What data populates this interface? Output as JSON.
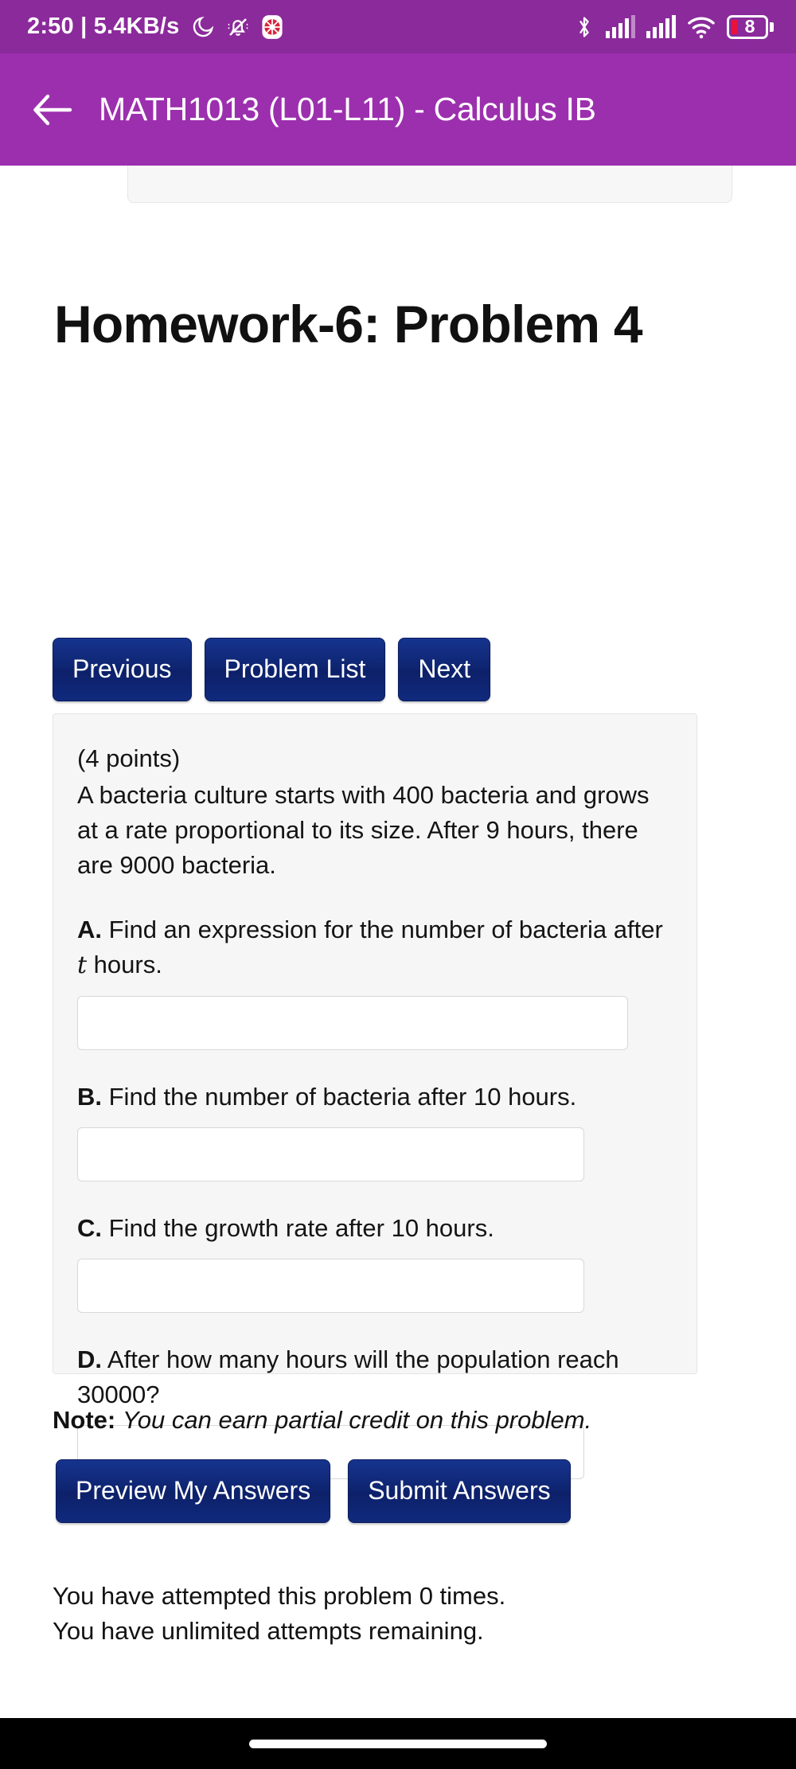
{
  "status_bar": {
    "clock": "2:50",
    "separator": "|",
    "network_speed": "5.4KB/s",
    "icons_left": [
      "dnd-moon-icon",
      "mute-bell-icon",
      "app-badge-icon"
    ],
    "icons_right": [
      "bluetooth-icon",
      "signal-sim1-icon",
      "signal-sim2-icon",
      "wifi-icon"
    ],
    "battery_level": "8",
    "battery_color": "#e8123c",
    "background_color": "#8b2a9b"
  },
  "app_bar": {
    "back_icon": "arrow-left-icon",
    "title": "MATH1013 (L01-L11) - Calculus IB",
    "background_color": "#9c2fae"
  },
  "breadcrumb": {
    "set_name": "homework-6",
    "separator": "/",
    "problem": "4"
  },
  "page": {
    "title": "Homework-6: Problem 4"
  },
  "nav_buttons": {
    "previous": "Previous",
    "problem_list": "Problem List",
    "next": "Next",
    "color": "#0e2470"
  },
  "problem": {
    "points": "(4 points)",
    "statement": "A bacteria culture starts with 400 bacteria and grows at a rate proportional to its size. After 9 hours, there are 9000 bacteria.",
    "parts": [
      {
        "label": "A.",
        "text_before": "Find an expression for the number of bacteria after ",
        "math_var": "t",
        "text_after": " hours.",
        "input_value": "",
        "input_placeholder": ""
      },
      {
        "label": "B.",
        "text_before": "Find the number of bacteria after 10 hours.",
        "math_var": "",
        "text_after": "",
        "input_value": "",
        "input_placeholder": ""
      },
      {
        "label": "C.",
        "text_before": "Find the growth rate after 10 hours.",
        "math_var": "",
        "text_after": "",
        "input_value": "",
        "input_placeholder": ""
      },
      {
        "label": "D.",
        "text_before": "After how many hours will the population reach 30000?",
        "math_var": "",
        "text_after": "",
        "input_value": "",
        "input_placeholder": ""
      }
    ]
  },
  "note": {
    "label": "Note:",
    "text": "You can earn partial credit on this problem."
  },
  "submit_buttons": {
    "preview": "Preview My Answers",
    "submit": "Submit Answers"
  },
  "attempts": {
    "line1": "You have attempted this problem 0 times.",
    "line2": "You have unlimited attempts remaining."
  },
  "gesture_bar": {
    "handle": "home-gesture-pill"
  }
}
